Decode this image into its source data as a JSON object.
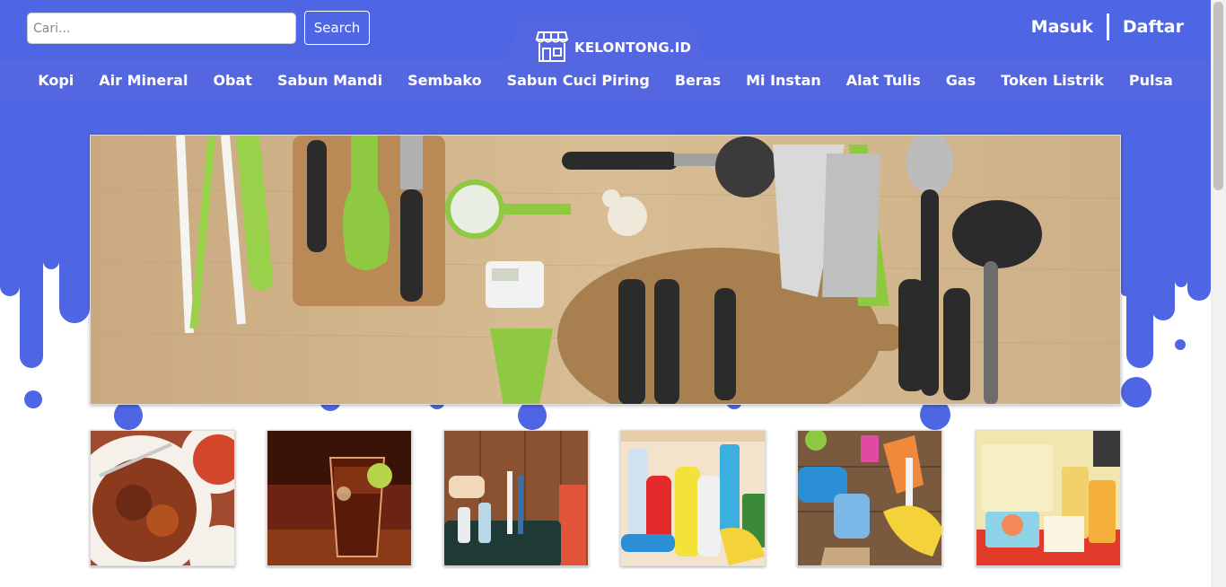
{
  "search": {
    "placeholder": "Cari...",
    "button_label": "Search"
  },
  "logo": {
    "text": "KELONTONG.ID",
    "icon": "store-icon"
  },
  "auth": {
    "login_label": "Masuk",
    "register_label": "Daftar"
  },
  "nav": {
    "items": [
      "Kopi",
      "Air Mineral",
      "Obat",
      "Sabun Mandi",
      "Sembako",
      "Sabun Cuci Piring",
      "Beras",
      "Mi Instan",
      "Alat Tulis",
      "Gas",
      "Token Listrik",
      "Pulsa"
    ]
  },
  "banner": {
    "icon": "kitchen-utensils-photo"
  },
  "tiles": [
    {
      "icon": "food-photo"
    },
    {
      "icon": "iced-drink-photo"
    },
    {
      "icon": "toiletries-photo"
    },
    {
      "icon": "cleaning-bottles-photo"
    },
    {
      "icon": "cleaning-tools-photo"
    },
    {
      "icon": "baby-care-photo"
    }
  ],
  "colors": {
    "brand": "#4f66e4",
    "nav": "#5466e0",
    "text_on_brand": "#ffffff"
  }
}
